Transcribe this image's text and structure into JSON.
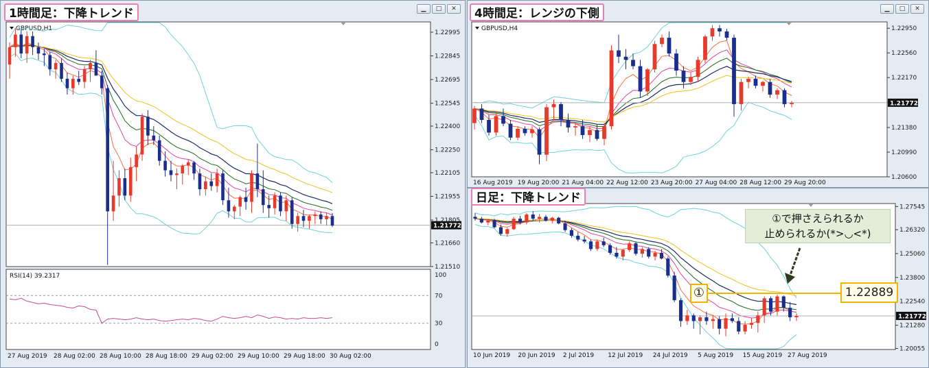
{
  "chart_data": [
    {
      "type": "candlestick",
      "title": "1時間足：下降トレンド",
      "symbol": "GBPUSD,H1",
      "ylim": [
        1.2151,
        1.2306
      ],
      "y_ticks": [
        "1.22995",
        "1.22845",
        "1.22695",
        "1.22545",
        "1.22400",
        "1.22250",
        "1.22105",
        "1.21955",
        "1.21805",
        "1.21660",
        "1.21510"
      ],
      "current_price": "1.21772",
      "x_labels": [
        "27 Aug 2019",
        "28 Aug 02:00",
        "28 Aug 10:00",
        "28 Aug 18:00",
        "29 Aug 02:00",
        "29 Aug 10:00",
        "29 Aug 18:00",
        "30 Aug 02:00"
      ],
      "candles": [
        [
          1.2279,
          1.2293,
          1.227,
          1.229
        ],
        [
          1.229,
          1.2302,
          1.2284,
          1.2298
        ],
        [
          1.2298,
          1.2301,
          1.2283,
          1.2286
        ],
        [
          1.2286,
          1.23,
          1.228,
          1.2297
        ],
        [
          1.2297,
          1.23,
          1.2285,
          1.229
        ],
        [
          1.229,
          1.2293,
          1.2282,
          1.2286
        ],
        [
          1.2286,
          1.2289,
          1.2278,
          1.2285
        ],
        [
          1.2285,
          1.2287,
          1.2272,
          1.2276
        ],
        [
          1.2276,
          1.2282,
          1.227,
          1.228
        ],
        [
          1.228,
          1.2283,
          1.2268,
          1.227
        ],
        [
          1.227,
          1.2274,
          1.226,
          1.2264
        ],
        [
          1.2264,
          1.2272,
          1.226,
          1.227
        ],
        [
          1.227,
          1.2275,
          1.2266,
          1.2268
        ],
        [
          1.2268,
          1.2278,
          1.2264,
          1.2276
        ],
        [
          1.2276,
          1.2282,
          1.2268,
          1.228
        ],
        [
          1.228,
          1.2288,
          1.2275,
          1.2272
        ],
        [
          1.2272,
          1.2275,
          1.226,
          1.2264
        ],
        [
          1.2264,
          1.2266,
          1.2152,
          1.2186
        ],
        [
          1.2186,
          1.2218,
          1.218,
          1.2196
        ],
        [
          1.2196,
          1.2212,
          1.2189,
          1.2207
        ],
        [
          1.2207,
          1.2213,
          1.2193,
          1.2196
        ],
        [
          1.2196,
          1.222,
          1.2192,
          1.2214
        ],
        [
          1.2214,
          1.2227,
          1.2205,
          1.2222
        ],
        [
          1.2222,
          1.2248,
          1.2218,
          1.2246
        ],
        [
          1.2246,
          1.225,
          1.2228,
          1.2234
        ],
        [
          1.2234,
          1.224,
          1.2228,
          1.2231
        ],
        [
          1.2231,
          1.2234,
          1.2215,
          1.2218
        ],
        [
          1.2218,
          1.2224,
          1.2208,
          1.2212
        ],
        [
          1.2212,
          1.2218,
          1.2205,
          1.2209
        ],
        [
          1.2209,
          1.2213,
          1.22,
          1.221
        ],
        [
          1.221,
          1.2216,
          1.2203,
          1.2215
        ],
        [
          1.2215,
          1.2219,
          1.2209,
          1.2217
        ],
        [
          1.2217,
          1.2218,
          1.2206,
          1.221
        ],
        [
          1.221,
          1.2213,
          1.2196,
          1.22
        ],
        [
          1.22,
          1.2208,
          1.2196,
          1.2205
        ],
        [
          1.2205,
          1.221,
          1.2199,
          1.2202
        ],
        [
          1.2202,
          1.2213,
          1.2198,
          1.221
        ],
        [
          1.221,
          1.2212,
          1.219,
          1.2193
        ],
        [
          1.2193,
          1.2201,
          1.2182,
          1.2186
        ],
        [
          1.2186,
          1.219,
          1.2181,
          1.2189
        ],
        [
          1.2189,
          1.2196,
          1.2183,
          1.2195
        ],
        [
          1.2195,
          1.2201,
          1.2187,
          1.2192
        ],
        [
          1.2192,
          1.2212,
          1.2185,
          1.221
        ],
        [
          1.221,
          1.2229,
          1.2195,
          1.22
        ],
        [
          1.22,
          1.2212,
          1.2185,
          1.219
        ],
        [
          1.219,
          1.2196,
          1.2182,
          1.2188
        ],
        [
          1.2188,
          1.2198,
          1.2184,
          1.2196
        ],
        [
          1.2196,
          1.2198,
          1.2183,
          1.2186
        ],
        [
          1.2186,
          1.2196,
          1.218,
          1.2193
        ],
        [
          1.2193,
          1.2195,
          1.2175,
          1.2178
        ],
        [
          1.2178,
          1.2185,
          1.2173,
          1.2183
        ],
        [
          1.2183,
          1.2187,
          1.2176,
          1.218
        ],
        [
          1.218,
          1.2184,
          1.2175,
          1.2183
        ],
        [
          1.2183,
          1.2186,
          1.2178,
          1.2184
        ],
        [
          1.2184,
          1.2186,
          1.2178,
          1.2181
        ],
        [
          1.2181,
          1.2185,
          1.2177,
          1.2183
        ],
        [
          1.2183,
          1.2185,
          1.2176,
          1.2177
        ]
      ],
      "indicators": [
        "Bollinger Bands",
        "EMA",
        "RSI"
      ],
      "rsi": {
        "label": "RSI(14) 39.2317",
        "levels": [
          "100",
          "70",
          "30",
          "0"
        ],
        "values": [
          65,
          64,
          66,
          62,
          60,
          58,
          59,
          57,
          56,
          55,
          53,
          52,
          55,
          54,
          50,
          49,
          30,
          36,
          37,
          36,
          35,
          36,
          38,
          36,
          35,
          36,
          34,
          33,
          34,
          35,
          36,
          35,
          37,
          36,
          34,
          33,
          36,
          40,
          38,
          37,
          38,
          40,
          38,
          42,
          40,
          37,
          39,
          38,
          36,
          37,
          36,
          38,
          37,
          37,
          38,
          37,
          38
        ]
      }
    },
    {
      "type": "candlestick",
      "title": "4時間足：レンジの下側",
      "symbol": "GBPUSD,H4",
      "ylim": [
        1.206,
        1.2305
      ],
      "y_ticks": [
        "1.22950",
        "1.22560",
        "1.22170",
        "1.21780",
        "1.21380",
        "1.20990",
        "1.20600"
      ],
      "current_price": "1.21772",
      "x_labels": [
        "16 Aug 2019",
        "19 Aug 20:00",
        "21 Aug 04:00",
        "22 Aug 12:00",
        "23 Aug 20:00",
        "27 Aug 04:00",
        "28 Aug 12:00",
        "29 Aug 20:00"
      ],
      "candles": [
        [
          1.2145,
          1.2172,
          1.2135,
          1.2168
        ],
        [
          1.2168,
          1.2175,
          1.2145,
          1.215
        ],
        [
          1.215,
          1.2158,
          1.2125,
          1.213
        ],
        [
          1.213,
          1.216,
          1.2125,
          1.2156
        ],
        [
          1.2156,
          1.2168,
          1.214,
          1.2144
        ],
        [
          1.2144,
          1.215,
          1.2118,
          1.2122
        ],
        [
          1.2122,
          1.214,
          1.2118,
          1.2136
        ],
        [
          1.2136,
          1.214,
          1.2125,
          1.2129
        ],
        [
          1.2129,
          1.214,
          1.2122,
          1.2135
        ],
        [
          1.2135,
          1.2138,
          1.208,
          1.2095
        ],
        [
          1.2095,
          1.2175,
          1.2085,
          1.217
        ],
        [
          1.217,
          1.2182,
          1.215,
          1.2175
        ],
        [
          1.2175,
          1.2178,
          1.214,
          1.215
        ],
        [
          1.215,
          1.216,
          1.213,
          1.2138
        ],
        [
          1.2138,
          1.2146,
          1.2125,
          1.214
        ],
        [
          1.214,
          1.215,
          1.212,
          1.2126
        ],
        [
          1.2126,
          1.214,
          1.2115,
          1.2134
        ],
        [
          1.2134,
          1.2143,
          1.2117,
          1.212
        ],
        [
          1.212,
          1.2145,
          1.211,
          1.214
        ],
        [
          1.214,
          1.2268,
          1.2135,
          1.226
        ],
        [
          1.226,
          1.2285,
          1.224,
          1.225
        ],
        [
          1.225,
          1.2262,
          1.223,
          1.2245
        ],
        [
          1.2245,
          1.2255,
          1.223,
          1.2235
        ],
        [
          1.2235,
          1.2245,
          1.2185,
          1.2195
        ],
        [
          1.2195,
          1.2232,
          1.2188,
          1.223
        ],
        [
          1.223,
          1.2275,
          1.2225,
          1.227
        ],
        [
          1.227,
          1.2285,
          1.2265,
          1.228
        ],
        [
          1.228,
          1.229,
          1.225,
          1.2255
        ],
        [
          1.2255,
          1.2262,
          1.222,
          1.2228
        ],
        [
          1.2228,
          1.2235,
          1.22,
          1.221
        ],
        [
          1.221,
          1.2225,
          1.2205,
          1.2218
        ],
        [
          1.2218,
          1.225,
          1.221,
          1.2245
        ],
        [
          1.2245,
          1.2285,
          1.224,
          1.2282
        ],
        [
          1.2282,
          1.23,
          1.2275,
          1.2295
        ],
        [
          1.2295,
          1.23,
          1.2282,
          1.229
        ],
        [
          1.229,
          1.2294,
          1.2276,
          1.228
        ],
        [
          1.228,
          1.2285,
          1.2155,
          1.2175
        ],
        [
          1.2175,
          1.2215,
          1.2165,
          1.221
        ],
        [
          1.221,
          1.2218,
          1.22,
          1.2215
        ],
        [
          1.2215,
          1.222,
          1.22,
          1.2204
        ],
        [
          1.2204,
          1.2212,
          1.2195,
          1.221
        ],
        [
          1.221,
          1.2215,
          1.2185,
          1.219
        ],
        [
          1.219,
          1.22,
          1.2183,
          1.2197
        ],
        [
          1.2197,
          1.22,
          1.217,
          1.2175
        ],
        [
          1.2175,
          1.218,
          1.217,
          1.2177
        ]
      ],
      "indicators": [
        "Bollinger Bands",
        "EMA"
      ]
    },
    {
      "type": "candlestick",
      "title": "日足：下降トレンド",
      "ylim": [
        1.2,
        1.277
      ],
      "y_ticks": [
        "1.27545",
        "1.26320",
        "1.25060",
        "1.23800",
        "1.22540",
        "1.21280",
        "1.20055"
      ],
      "current_price": "1.21772",
      "x_labels": [
        "10 Jun 2019",
        "20 Jun 2019",
        "2 Jul 2019",
        "12 Jul 2019",
        "24 Jul 2019",
        "5 Aug 2019",
        "15 Aug 2019",
        "27 Aug 2019"
      ],
      "candles": [
        [
          1.27,
          1.272,
          1.268,
          1.269
        ],
        [
          1.269,
          1.27,
          1.2665,
          1.267
        ],
        [
          1.267,
          1.2685,
          1.2655,
          1.268
        ],
        [
          1.268,
          1.269,
          1.264,
          1.2645
        ],
        [
          1.2645,
          1.266,
          1.26,
          1.261
        ],
        [
          1.261,
          1.264,
          1.2595,
          1.2635
        ],
        [
          1.2635,
          1.27,
          1.263,
          1.269
        ],
        [
          1.269,
          1.2705,
          1.266,
          1.267
        ],
        [
          1.267,
          1.272,
          1.266,
          1.2712
        ],
        [
          1.2712,
          1.273,
          1.268,
          1.269
        ],
        [
          1.269,
          1.2715,
          1.267,
          1.27
        ],
        [
          1.27,
          1.271,
          1.2675,
          1.268
        ],
        [
          1.268,
          1.27,
          1.2665,
          1.2695
        ],
        [
          1.2695,
          1.27,
          1.266,
          1.2665
        ],
        [
          1.2665,
          1.268,
          1.262,
          1.263
        ],
        [
          1.263,
          1.264,
          1.259,
          1.26
        ],
        [
          1.26,
          1.262,
          1.257,
          1.258
        ],
        [
          1.258,
          1.26,
          1.256,
          1.257
        ],
        [
          1.257,
          1.258,
          1.252,
          1.253
        ],
        [
          1.253,
          1.258,
          1.252,
          1.257
        ],
        [
          1.257,
          1.259,
          1.254,
          1.255
        ],
        [
          1.255,
          1.256,
          1.25,
          1.251
        ],
        [
          1.251,
          1.254,
          1.248,
          1.249
        ],
        [
          1.249,
          1.253,
          1.247,
          1.2525
        ],
        [
          1.2525,
          1.257,
          1.2515,
          1.256
        ],
        [
          1.256,
          1.257,
          1.2495,
          1.2505
        ],
        [
          1.2505,
          1.254,
          1.2485,
          1.253
        ],
        [
          1.253,
          1.254,
          1.248,
          1.249
        ],
        [
          1.249,
          1.252,
          1.247,
          1.251
        ],
        [
          1.251,
          1.253,
          1.2475,
          1.248
        ],
        [
          1.248,
          1.249,
          1.238,
          1.239
        ],
        [
          1.239,
          1.241,
          1.225,
          1.226
        ],
        [
          1.226,
          1.227,
          1.212,
          1.215
        ],
        [
          1.215,
          1.221,
          1.213,
          1.218
        ],
        [
          1.218,
          1.219,
          1.211,
          1.215
        ],
        [
          1.215,
          1.218,
          1.208,
          1.217
        ],
        [
          1.217,
          1.22,
          1.213,
          1.215
        ],
        [
          1.215,
          1.218,
          1.211,
          1.216
        ],
        [
          1.216,
          1.2175,
          1.208,
          1.211
        ],
        [
          1.211,
          1.219,
          1.207,
          1.2165
        ],
        [
          1.2165,
          1.219,
          1.214,
          1.215
        ],
        [
          1.215,
          1.217,
          1.208,
          1.2095
        ],
        [
          1.2095,
          1.215,
          1.208,
          1.213
        ],
        [
          1.213,
          1.2165,
          1.211,
          1.214
        ],
        [
          1.214,
          1.22,
          1.209,
          1.218
        ],
        [
          1.218,
          1.228,
          1.214,
          1.227
        ],
        [
          1.227,
          1.228,
          1.218,
          1.22
        ],
        [
          1.22,
          1.229,
          1.218,
          1.228
        ],
        [
          1.228,
          1.2285,
          1.22,
          1.222
        ],
        [
          1.222,
          1.225,
          1.215,
          1.217
        ],
        [
          1.217,
          1.219,
          1.215,
          1.2177
        ]
      ],
      "indicators": [
        "Bollinger Bands",
        "EMA"
      ],
      "resistance_level": "1.22889",
      "resistance_marker": "①",
      "annotation": [
        "①で押さえられるか",
        "止められるか(*>◡<*)"
      ]
    }
  ],
  "colors": {
    "bull": "#e8392b",
    "bear": "#1a2f8c",
    "bollinger": "#6dd3d8",
    "ema_fast": "#ff6a3d",
    "ema_2": "#e1429c",
    "ema_3": "#1d6a1d",
    "ema_4": "#1b2a66",
    "ema_5": "#f0c020",
    "rsi": "#c64d8e",
    "price_line": "#b0b0b0",
    "caption_border": "#e67fb4",
    "level_line": "#f0b400"
  }
}
